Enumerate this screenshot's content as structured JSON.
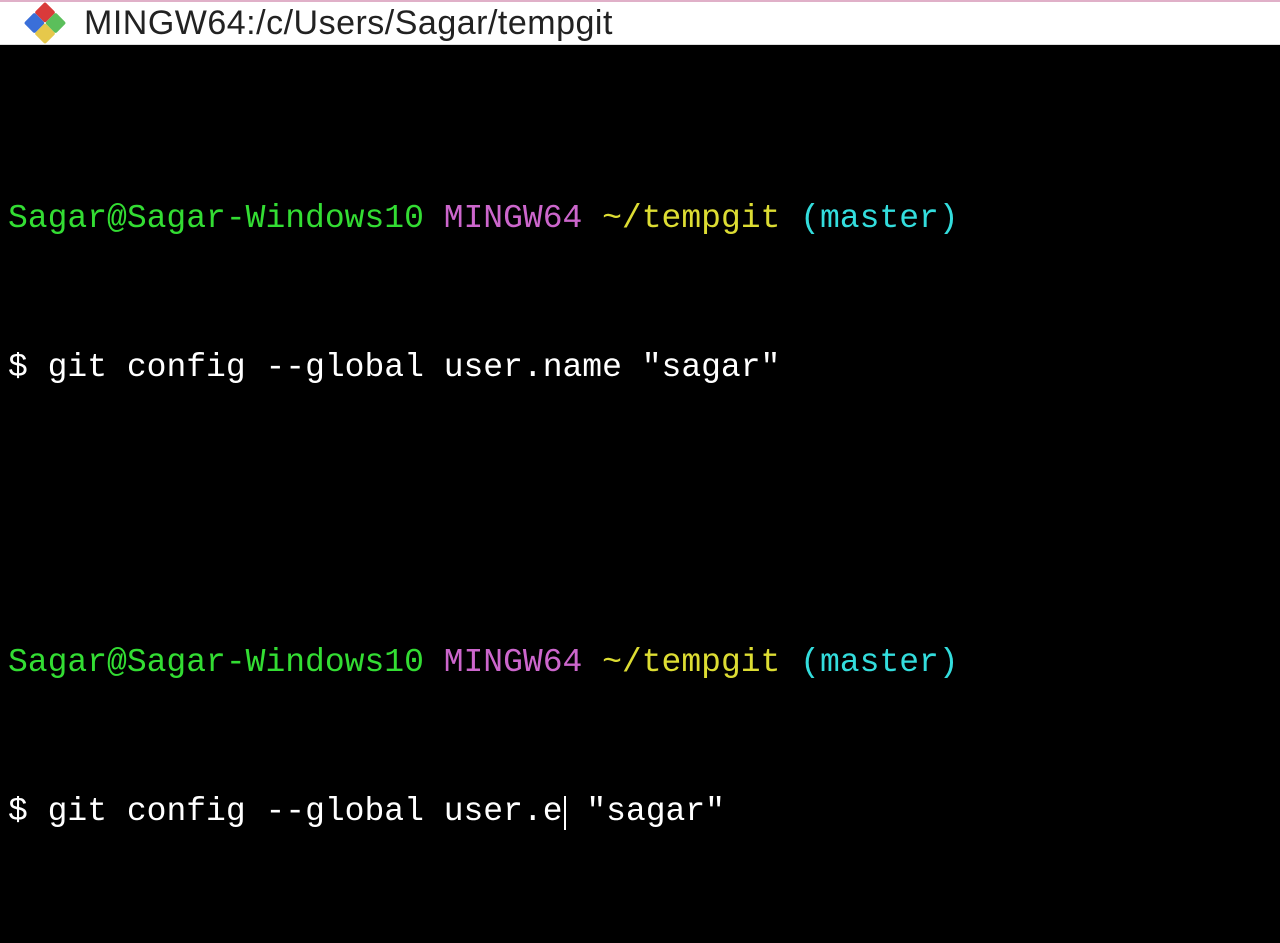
{
  "window": {
    "title": "MINGW64:/c/Users/Sagar/tempgit"
  },
  "prompt1": {
    "userhost": "Sagar@Sagar-Windows10",
    "env": "MINGW64",
    "path": "~/tempgit",
    "branch": "(master)",
    "symbol": "$",
    "command": "git config --global user.name \"sagar\""
  },
  "prompt2": {
    "userhost": "Sagar@Sagar-Windows10",
    "env": "MINGW64",
    "path": "~/tempgit",
    "branch": "(master)",
    "symbol": "$",
    "command_before_cursor": "git config --global user.e",
    "command_after_cursor": " \"sagar\""
  }
}
